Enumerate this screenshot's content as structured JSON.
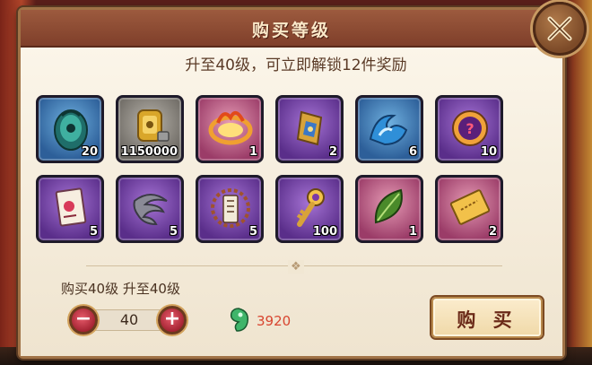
{
  "dialog": {
    "title": "购买等级",
    "subtitle": "升至40级，可立即解锁12件奖励",
    "close_icon": "close-x-icon"
  },
  "rewards": [
    {
      "icon": "jade-token-icon",
      "rarity": "blue",
      "count": "20"
    },
    {
      "icon": "gold-coin-bag-icon",
      "rarity": "grey",
      "count": "1150000"
    },
    {
      "icon": "fire-ring-icon",
      "rarity": "pink",
      "count": "1"
    },
    {
      "icon": "gold-pendant-icon",
      "rarity": "purple",
      "count": "2"
    },
    {
      "icon": "water-wave-icon",
      "rarity": "blue",
      "count": "6"
    },
    {
      "icon": "mystery-orb-icon",
      "rarity": "purple",
      "count": "10"
    },
    {
      "icon": "talisman-card-icon",
      "rarity": "purple",
      "count": "5"
    },
    {
      "icon": "storm-cloud-icon",
      "rarity": "purple",
      "count": "5"
    },
    {
      "icon": "beaded-scroll-icon",
      "rarity": "purple",
      "count": "5"
    },
    {
      "icon": "golden-key-icon",
      "rarity": "purple",
      "count": "100"
    },
    {
      "icon": "green-leaf-gem-icon",
      "rarity": "pink",
      "count": "1"
    },
    {
      "icon": "gold-ticket-icon",
      "rarity": "pink",
      "count": "2"
    }
  ],
  "purchase": {
    "label": "购买40级 升至40级",
    "quantity": "40",
    "minus_icon": "minus-icon",
    "plus_icon": "plus-icon",
    "currency_icon": "green-jade-icon",
    "cost": "3920",
    "buy_label": "购 买"
  },
  "colors": {
    "header": "#8a4a32",
    "panel": "#f3ead8",
    "cost_text": "#d8452f",
    "step_button": "#c3303f"
  }
}
